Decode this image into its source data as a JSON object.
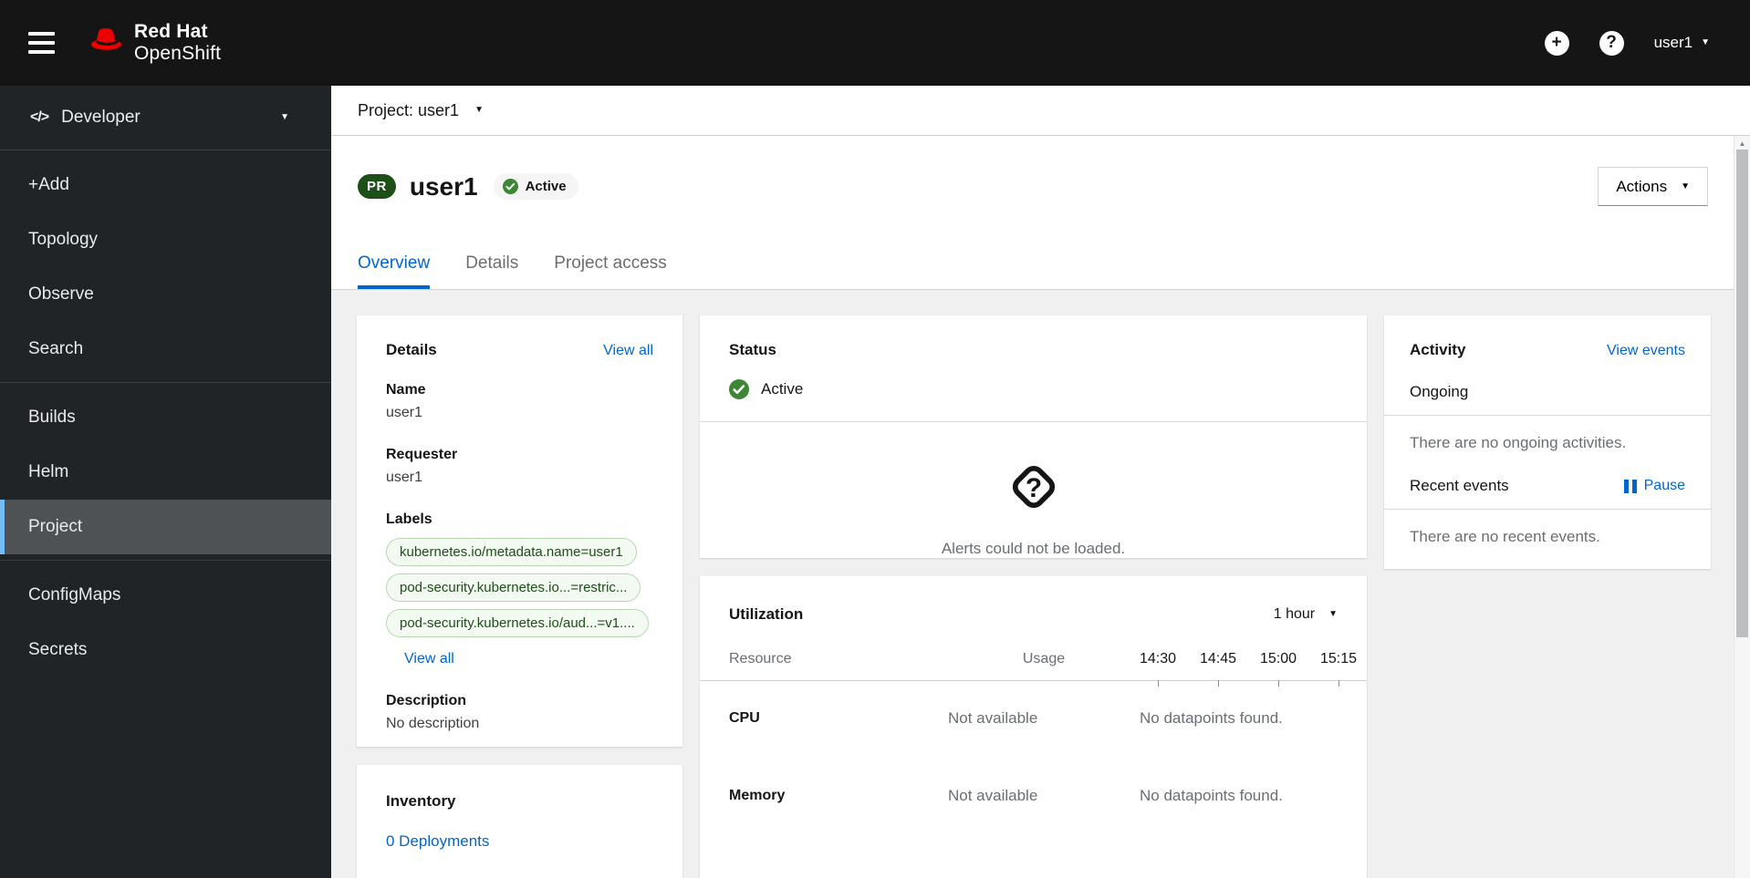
{
  "masthead": {
    "logo_line1": "Red Hat",
    "logo_line2": "OpenShift",
    "username": "user1"
  },
  "sidebar": {
    "perspective": "Developer",
    "groups": [
      [
        "+Add",
        "Topology",
        "Observe",
        "Search"
      ],
      [
        "Builds",
        "Helm",
        "Project"
      ],
      [
        "ConfigMaps",
        "Secrets"
      ]
    ],
    "selected_item": "Project"
  },
  "context_bar": {
    "project_label": "Project: user1"
  },
  "page_header": {
    "badge": "PR",
    "title": "user1",
    "status_badge": "Active",
    "actions_label": "Actions"
  },
  "tabs": {
    "items": [
      "Overview",
      "Details",
      "Project access"
    ],
    "active": "Overview"
  },
  "details_card": {
    "title": "Details",
    "view_all": "View all",
    "name_label": "Name",
    "name_value": "user1",
    "requester_label": "Requester",
    "requester_value": "user1",
    "labels_label": "Labels",
    "labels": [
      "kubernetes.io/metadata.name=user1",
      "pod-security.kubernetes.io...=restric...",
      "pod-security.kubernetes.io/aud...=v1...."
    ],
    "labels_view_all": "View all",
    "description_label": "Description",
    "description_value": "No description"
  },
  "status_card": {
    "title": "Status",
    "status": "Active",
    "alerts_message": "Alerts could not be loaded."
  },
  "utilization_card": {
    "title": "Utilization",
    "duration": "1 hour",
    "col_resource": "Resource",
    "col_usage": "Usage",
    "times": [
      "14:30",
      "14:45",
      "15:00",
      "15:15"
    ],
    "rows": [
      {
        "resource": "CPU",
        "usage": "Not available",
        "datapoints": "No datapoints found."
      },
      {
        "resource": "Memory",
        "usage": "Not available",
        "datapoints": "No datapoints found."
      }
    ]
  },
  "activity_card": {
    "title": "Activity",
    "view_events": "View events",
    "ongoing_label": "Ongoing",
    "no_ongoing": "There are no ongoing activities.",
    "recent_label": "Recent events",
    "pause_label": "Pause",
    "no_recent": "There are no recent events."
  },
  "inventory_card": {
    "title": "Inventory",
    "items": [
      "0 Deployments"
    ]
  },
  "colors": {
    "accent_blue": "#0066cc",
    "success_green": "#3e8635",
    "project_badge_green": "#1e4f18",
    "label_pill_bg": "#f3faf2",
    "label_pill_border": "#b9d8b2",
    "masthead_bg": "#151515",
    "sidebar_bg": "#212427",
    "sidebar_selected_bg": "#4f5255",
    "sidebar_selected_bar": "#73bcf7",
    "content_bg": "#f0f0f0"
  }
}
